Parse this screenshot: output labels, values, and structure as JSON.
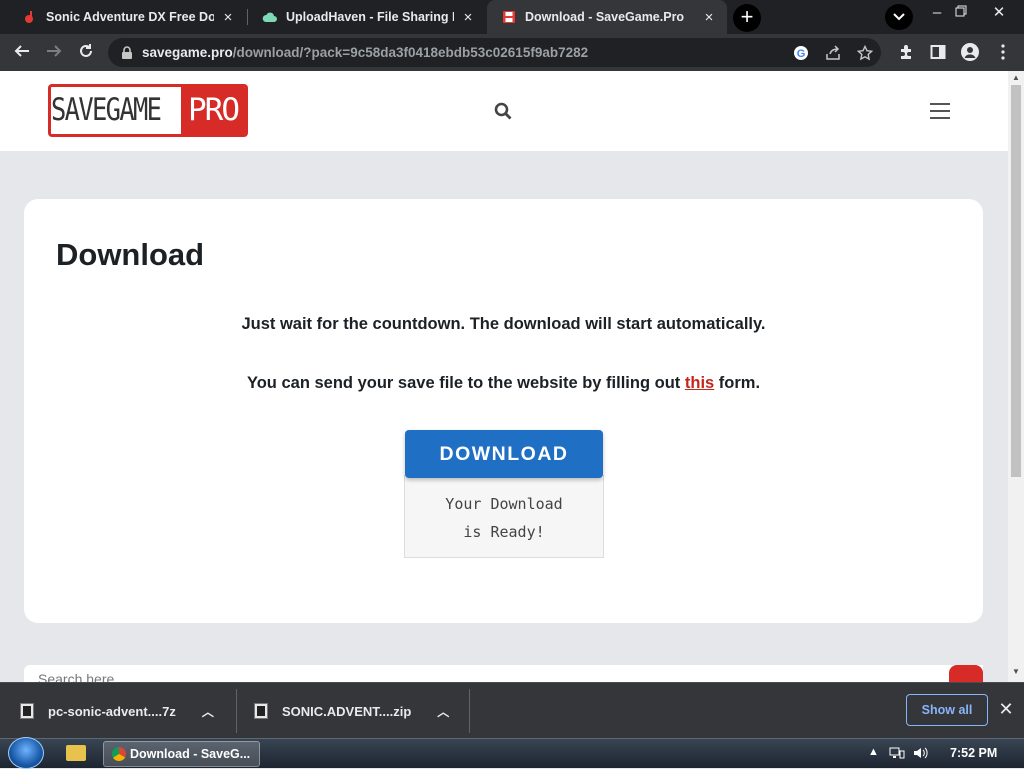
{
  "browser": {
    "tabs": [
      {
        "title": "Sonic Adventure DX Free Dow",
        "favicon": "red-game-icon",
        "active": false
      },
      {
        "title": "UploadHaven - File Sharing M",
        "favicon": "cloud-icon",
        "active": false
      },
      {
        "title": "Download - SaveGame.Pro",
        "favicon": "floppy-disk-icon",
        "active": true
      }
    ],
    "close_glyph": "×",
    "new_tab_glyph": "+",
    "url_host": "savegame.pro",
    "url_path": "/download/?pack=9c58da3f0418ebdb53c02615f9ab7282"
  },
  "site": {
    "logo_left": "SAVEGAME",
    "logo_right": "PRO",
    "brand_color": "#d62b27"
  },
  "main": {
    "heading": "Download",
    "wait_message": "Just wait for the countdown. The download will start automatically.",
    "send_prefix": "You can send your save file to the website by filling out ",
    "send_link": "this",
    "send_suffix": " form.",
    "download_button": "DOWNLOAD",
    "ready_line1": "Your Download",
    "ready_line2": "is Ready!",
    "search_placeholder": "Search here..."
  },
  "downloads": {
    "items": [
      {
        "name": "pc-sonic-advent....7z"
      },
      {
        "name": "SONIC.ADVENT....zip"
      }
    ],
    "show_all": "Show all"
  },
  "taskbar": {
    "task_label": "Download - SaveG...",
    "clock": "7:52 PM"
  }
}
